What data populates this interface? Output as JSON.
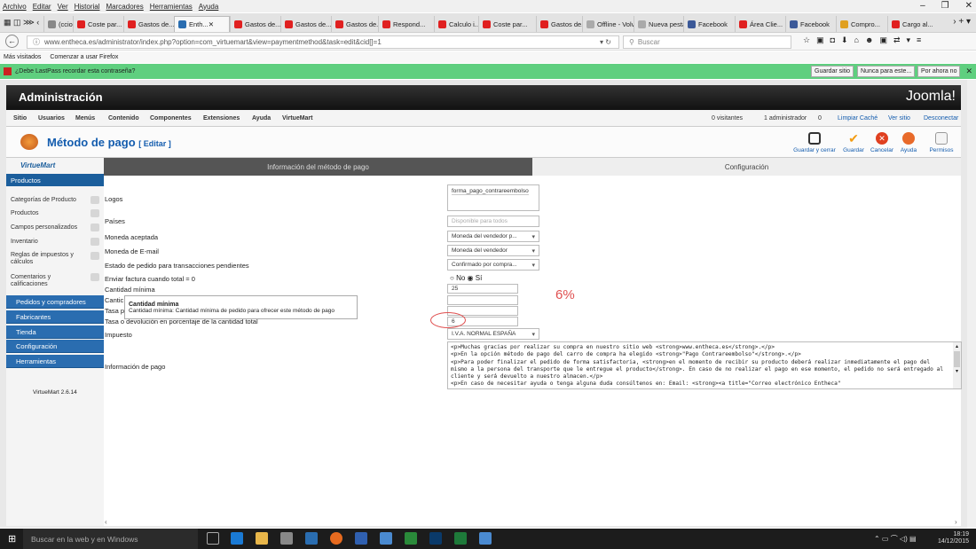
{
  "menubar": [
    "Archivo",
    "Editar",
    "Ver",
    "Historial",
    "Marcadores",
    "Herramientas",
    "Ayuda"
  ],
  "tabs": [
    {
      "label": "(ccio...",
      "color": "#888"
    },
    {
      "label": "Coste par...",
      "color": "#e02020"
    },
    {
      "label": "Gastos de...",
      "color": "#e02020"
    },
    {
      "label": "Enth...",
      "color": "#2a6db0",
      "active": true
    },
    {
      "label": "Gastos de...",
      "color": "#e02020"
    },
    {
      "label": "Gastos de...",
      "color": "#e02020"
    },
    {
      "label": "Gastos de...",
      "color": "#e02020"
    },
    {
      "label": "Respond...",
      "color": "#e02020"
    },
    {
      "label": "Calculo i...",
      "color": "#e02020"
    },
    {
      "label": "Coste par...",
      "color": "#e02020"
    },
    {
      "label": "Gastos de...",
      "color": "#e02020"
    },
    {
      "label": "Offline - Volv...",
      "color": "#aaa"
    },
    {
      "label": "Nueva pestaña",
      "color": "#aaa"
    },
    {
      "label": "Facebook",
      "color": "#3b5998"
    },
    {
      "label": "Área Clie...",
      "color": "#e02020"
    },
    {
      "label": "Facebook",
      "color": "#3b5998"
    },
    {
      "label": "Compro...",
      "color": "#e0a020"
    },
    {
      "label": "Cargo al...",
      "color": "#e02020"
    }
  ],
  "nav": {
    "url": "www.entheca.es/administrator/index.php?option=com_virtuemart&view=paymentmethod&task=edit&cid[]=1",
    "search_placeholder": "Buscar"
  },
  "bookmarks": [
    "Más visitados",
    "Comenzar a usar Firefox"
  ],
  "lastpass": {
    "question": "¿Debe LastPass recordar esta contraseña?",
    "save": "Guardar sitio",
    "never": "Nunca para este...",
    "notnow": "Por ahora no"
  },
  "admin": {
    "title": "Administración",
    "logo": "Joomla!"
  },
  "topmenu": [
    "Sitio",
    "Usuarios",
    "Menús",
    "Contenido",
    "Componentes",
    "Extensiones",
    "Ayuda",
    "VirtueMart"
  ],
  "status": {
    "visitors": "0 visitantes",
    "admins": "1 administrador",
    "count": "0",
    "cache": "Limpiar Caché",
    "view": "Ver sitio",
    "logout": "Desconectar"
  },
  "page_title": "Método de pago",
  "edit_tag": "[ Editar ]",
  "toolbar": [
    "Guardar y cerrar",
    "Guardar",
    "Cancelar",
    "Ayuda",
    "Permisos"
  ],
  "sidebar": {
    "brand": "VirtueMart",
    "header": "Productos",
    "items": [
      "Categorías de Producto",
      "Productos",
      "Campos personalizados",
      "Inventario",
      "Reglas de impuestos y cálculos",
      "Comentarios y calificaciones"
    ],
    "groups": [
      "Pedidos y compradores",
      "Fabricantes",
      "Tienda",
      "Configuración",
      "Herramientas"
    ],
    "version": "VirtueMart 2.6.14"
  },
  "content_tabs": {
    "info": "Información del método de pago",
    "config": "Configuración"
  },
  "form": {
    "logos": "Logos",
    "logos_value": "forma_pago_contrareembolso",
    "paises": "Países",
    "paises_ph": "Disponible para todos",
    "moneda": "Moneda aceptada",
    "moneda_value": "Moneda del vendedor p...",
    "email": "Moneda de E-mail",
    "email_value": "Moneda del vendedor",
    "estado": "Estado de pedido para transacciones pendientes",
    "estado_value": "Confirmado por compra...",
    "factura": "Enviar factura cuando total = 0",
    "no": "No",
    "si": "Sí",
    "cantidad": "Cantidad mínima",
    "cantidad_value": "25",
    "cantidad_max_trunc": "Cantic",
    "tasa_trunc": "Tasa p",
    "tasa_dev": "Tasa o devolución en porcentaje de la cantidad total",
    "tasa_value": "6",
    "impuesto": "Impuesto",
    "impuesto_value": "I.V.A. NORMAL ESPAÑA",
    "info_pago": "Información de pago",
    "info_text": "<p>Muchas gracias por realizar su compra en nuestro sitio web <strong>www.entheca.es</strong>.</p>\n<p>En la opción método de pago del carro de compra ha elegido <strong>\"Pago Contrareembolso\"</strong>.</p>\n<p>Para poder finalizar el pedido de forma satisfactoria, <strong>en el momento de recibir su producto deberá realizar inmediatamente el pago del mismo a la persona del transporte que le entregue el producto</strong>. En caso de no realizar el pago en ese momento, el pedido no será entregado al cliente y será devuelto a nuestro almacen.</p>\n<p>En caso de necesitar ayuda o tenga alguna duda consúltenos en: Email: <strong><a title=\"Correo electrónico Entheca\""
  },
  "tooltip": {
    "title": "Cantidad mínima",
    "body": "Cantidad mínima: Cantidad mínima de pedido para ofrecer este método de pago"
  },
  "annotation": "6%",
  "taskbar": {
    "search": "Buscar en la web y en Windows",
    "time": "18:19",
    "date": "14/12/2015"
  }
}
